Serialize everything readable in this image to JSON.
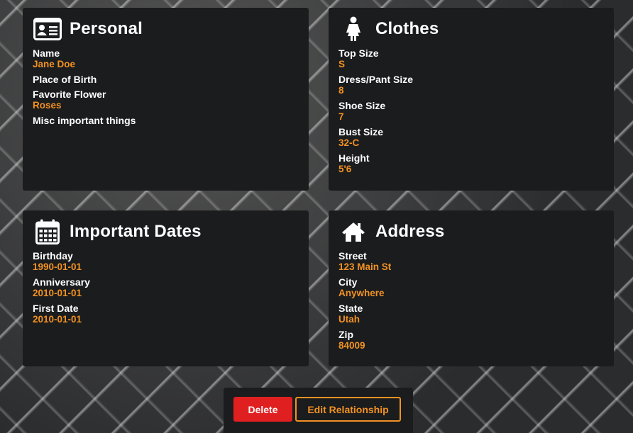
{
  "personal": {
    "title": "Personal",
    "icon": "id-card-icon",
    "fields": [
      {
        "label": "Name",
        "value": "Jane Doe"
      },
      {
        "label": "Place of Birth",
        "value": ""
      },
      {
        "label": "Favorite Flower",
        "value": "Roses"
      },
      {
        "label": "Misc important things",
        "value": ""
      }
    ]
  },
  "clothes": {
    "title": "Clothes",
    "icon": "female-icon",
    "fields": [
      {
        "label": "Top Size",
        "value": "S"
      },
      {
        "label": "Dress/Pant Size",
        "value": "8"
      },
      {
        "label": "Shoe Size",
        "value": "7"
      },
      {
        "label": "Bust Size",
        "value": "32-C"
      },
      {
        "label": "Height",
        "value": "5'6"
      }
    ]
  },
  "dates": {
    "title": "Important Dates",
    "icon": "calendar-icon",
    "fields": [
      {
        "label": "Birthday",
        "value": "1990-01-01"
      },
      {
        "label": "Anniversary",
        "value": "2010-01-01"
      },
      {
        "label": "First Date",
        "value": "2010-01-01"
      }
    ]
  },
  "address": {
    "title": "Address",
    "icon": "home-icon",
    "fields": [
      {
        "label": "Street",
        "value": "123 Main St"
      },
      {
        "label": "City",
        "value": "Anywhere"
      },
      {
        "label": "State",
        "value": "Utah"
      },
      {
        "label": "Zip",
        "value": "84009"
      }
    ]
  },
  "actions": {
    "delete_label": "Delete",
    "edit_label": "Edit Relationship"
  },
  "colors": {
    "accent": "#f29222",
    "danger": "#e02020",
    "card_bg": "#1b1c1e"
  }
}
